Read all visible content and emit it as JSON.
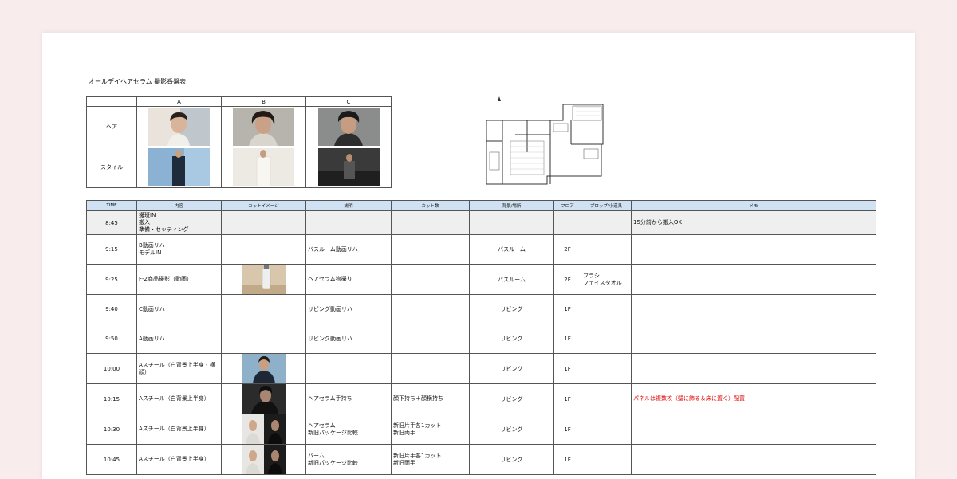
{
  "document": {
    "title": "オールデイヘアセラム 撮影香盤表"
  },
  "style_grid": {
    "columns": [
      "A",
      "B",
      "C"
    ],
    "rows": [
      {
        "label": "ヘア"
      },
      {
        "label": "スタイル"
      }
    ]
  },
  "schedule": {
    "headers": [
      "TIME",
      "内容",
      "カットイメージ",
      "説明",
      "カット数",
      "背景/場所",
      "フロア",
      "プロップ/小道具",
      "メモ"
    ],
    "rows": [
      {
        "time": "8:45",
        "content": "撮班IN\n搬入\n準備・セッティング",
        "desc": "",
        "cuts": "",
        "location": "",
        "floor": "",
        "props": "",
        "memo": "15分前から搬入OK",
        "memo_red": false,
        "img": "none"
      },
      {
        "time": "9:15",
        "content": "B動画リハ\nモデルIN",
        "desc": "バスルーム動画リハ",
        "cuts": "",
        "location": "バスルーム",
        "floor": "2F",
        "props": "",
        "memo": "",
        "memo_red": false,
        "img": "none"
      },
      {
        "time": "9:25",
        "content": "F-2商品撮影（動画）",
        "desc": "ヘアセラム物撮り",
        "cuts": "",
        "location": "バスルーム",
        "floor": "2F",
        "props": "ブラシ\nフェイスタオル",
        "memo": "",
        "memo_red": false,
        "img": "product"
      },
      {
        "time": "9:40",
        "content": "C動画リハ",
        "desc": "リビング動画リハ",
        "cuts": "",
        "location": "リビング",
        "floor": "1F",
        "props": "",
        "memo": "",
        "memo_red": false,
        "img": "none"
      },
      {
        "time": "9:50",
        "content": "A動画リハ",
        "desc": "リビング動画リハ",
        "cuts": "",
        "location": "リビング",
        "floor": "1F",
        "props": "",
        "memo": "",
        "memo_red": false,
        "img": "none"
      },
      {
        "time": "10:00",
        "content": "Aスチール（白背景上半身・横\n顔）",
        "desc": "",
        "cuts": "",
        "location": "リビング",
        "floor": "1F",
        "props": "",
        "memo": "",
        "memo_red": false,
        "img": "suit"
      },
      {
        "time": "10:15",
        "content": "Aスチール（白背景上半身）",
        "desc": "ヘアセラム手持ち",
        "cuts": "顔下持ち＋顔横持ち",
        "location": "リビング",
        "floor": "1F",
        "props": "",
        "memo": "パネルは複数枚（壁に飾る＆床に置く）配置",
        "memo_red": true,
        "img": "dark"
      },
      {
        "time": "10:30",
        "content": "Aスチール（白背景上半身）",
        "desc": "ヘアセラム\n新旧パッケージ比較",
        "cuts": "新旧片手各1カット\n新旧両手",
        "location": "リビング",
        "floor": "1F",
        "props": "",
        "memo": "",
        "memo_red": false,
        "img": "pair"
      },
      {
        "time": "10:45",
        "content": "Aスチール（白背景上半身）",
        "desc": "バーム\n新旧パッケージ比較",
        "cuts": "新旧片手各1カット\n新旧両手",
        "location": "リビング",
        "floor": "1F",
        "props": "",
        "memo": "",
        "memo_red": false,
        "img": "pair"
      }
    ]
  }
}
